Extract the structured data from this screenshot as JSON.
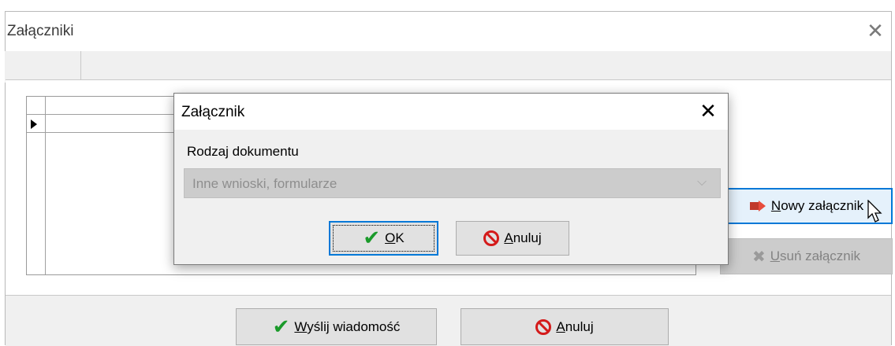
{
  "main_window": {
    "title": "Załączniki",
    "close_glyph": "✕"
  },
  "attachments": {
    "new_label_accel": "N",
    "new_label_rest": "owy załącznik",
    "remove_label_accel": "U",
    "remove_label_rest": "suń załącznik"
  },
  "footer": {
    "send_accel": "W",
    "send_rest": "yślij wiadomość",
    "cancel_accel": "A",
    "cancel_rest": "nuluj"
  },
  "dialog": {
    "title": "Załącznik",
    "close_glyph": "✕",
    "doc_type_label": "Rodzaj dokumentu",
    "doc_type_value": "Inne wnioski, formularze",
    "ok_accel": "O",
    "ok_rest": "K",
    "cancel_accel": "A",
    "cancel_rest": "nuluj"
  },
  "colors": {
    "accent": "#0078d7",
    "ok_check": "#1a9a2a",
    "cancel_sign": "#d41b1b"
  },
  "icons": [
    "close-icon",
    "row-pointer-icon",
    "add-attachment-icon",
    "remove-icon",
    "check-icon",
    "no-sign-icon",
    "chevron-down-icon",
    "mouse-cursor-icon"
  ]
}
